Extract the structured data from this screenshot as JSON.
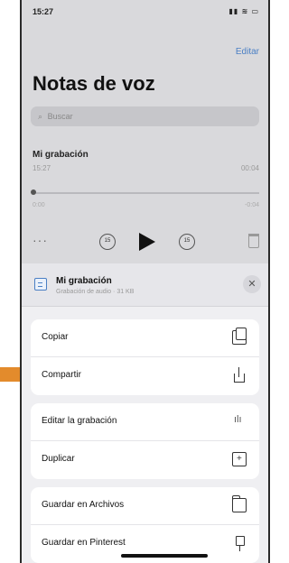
{
  "status_bar": {
    "time": "15:27",
    "icons": "▮▮ ≋ ▭"
  },
  "header": {
    "edit_label": "Editar",
    "title": "Notas de voz"
  },
  "search": {
    "placeholder": "Buscar",
    "icon": "search-icon"
  },
  "recording": {
    "title": "Mi grabación",
    "time": "15:27",
    "duration": "00:04",
    "position_start": "0:00",
    "position_end": "-0:04",
    "progress_fraction": 0.0
  },
  "controls": {
    "more": "···",
    "skip_back": "15",
    "skip_forward": "15"
  },
  "share_sheet": {
    "title": "Mi grabación",
    "subtitle": "Grabación de audio · 31 KB",
    "close": "✕",
    "actions": [
      {
        "label": "Copiar",
        "icon": "copy-icon"
      },
      {
        "label": "Compartir",
        "icon": "share-icon"
      },
      {
        "label": "Editar la grabación",
        "icon": "waveform-icon"
      },
      {
        "label": "Duplicar",
        "icon": "duplicate-icon"
      },
      {
        "label": "Guardar en Archivos",
        "icon": "folder-icon"
      },
      {
        "label": "Guardar en Pinterest",
        "icon": "pin-icon"
      }
    ]
  },
  "colors": {
    "accent": "#4a7fc4",
    "annotation_arrow": "#e38b2c"
  }
}
